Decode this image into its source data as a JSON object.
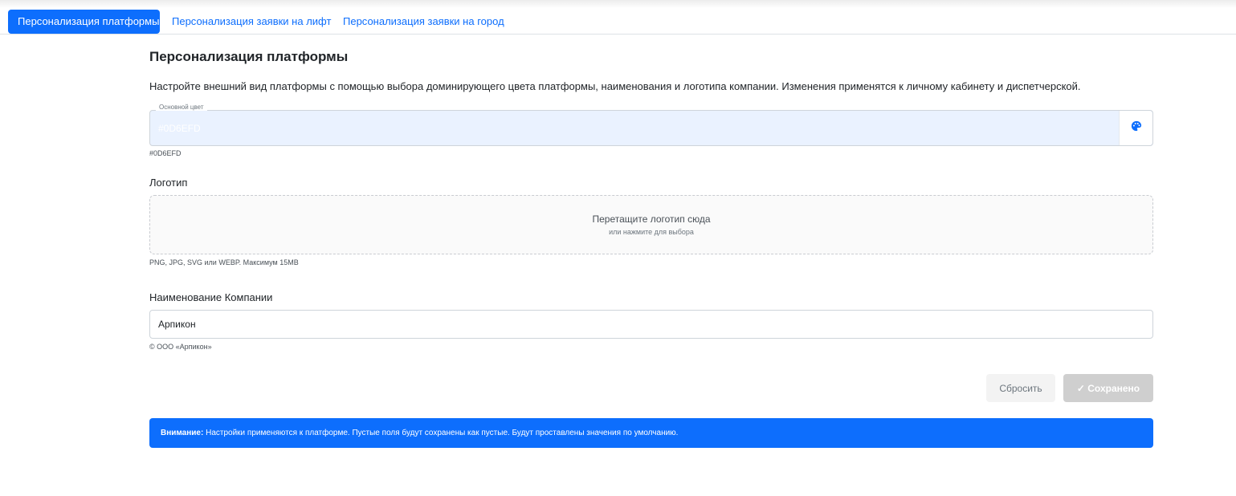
{
  "tabs": [
    {
      "label": "Персонализация платформы",
      "active": true
    },
    {
      "label": "Персонализация заявки на лифт",
      "active": false
    },
    {
      "label": "Персонализация заявки на город",
      "active": false
    }
  ],
  "page": {
    "title": "Персонализация платформы",
    "description": "Настройте внешний вид платформы с помощью выбора доминирующего цвета платформы, наименования и логотипа компании. Изменения применятся к личному кабинету и диспетчерской."
  },
  "color": {
    "label": "Основной цвет",
    "value": "#0D6EFD",
    "hint": "#0D6EFD",
    "icon": "palette-icon",
    "accent": "#0d6efd"
  },
  "logo": {
    "label": "Логотип",
    "drop_main": "Перетащите логотип сюда",
    "drop_sub": "или нажмите для выбора",
    "hint": "PNG, JPG, SVG или WEBP. Максимум 15MB"
  },
  "company": {
    "label": "Наименование Компании",
    "value": "Арпикон",
    "hint": "© ООО «Арпикон»"
  },
  "actions": {
    "reset_label": "Сбросить",
    "saved_label": "✓ Сохранено"
  },
  "alert": {
    "strong": "Внимание:",
    "text": " Настройки применяются к платформе. Пустые поля будут сохранены как пустые. Будут проставлены значения по умолчанию."
  }
}
